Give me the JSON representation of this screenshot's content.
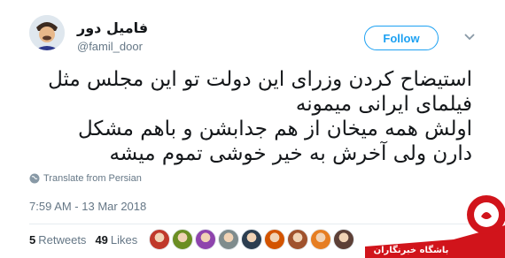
{
  "user": {
    "display_name": "فامیل دور",
    "handle": "@famil_door"
  },
  "follow_label": "Follow",
  "tweet_lines": [
    "استیضاح کردن وزرای این دولت تو این مجلس مثل",
    "فیلمای ایرانی میمونه",
    "اولش همه میخان از هم جدابشن و باهم مشکل",
    "دارن ولی آخرش به خیر خوشی تموم میشه"
  ],
  "translate_label": "Translate from Persian",
  "timestamp": "7:59 AM - 13 Mar 2018",
  "retweets": {
    "count": "5",
    "label": "Retweets"
  },
  "likes": {
    "count": "49",
    "label": "Likes"
  },
  "liker_colors": [
    "#c0392b",
    "#6b8e23",
    "#8e44ad",
    "#7f8c8d",
    "#2c3e50",
    "#d35400",
    "#a0522d",
    "#e67e22",
    "#5d4037"
  ],
  "watermark": {
    "label": "باشگاه خبرنگاران",
    "color": "#d1141b"
  }
}
